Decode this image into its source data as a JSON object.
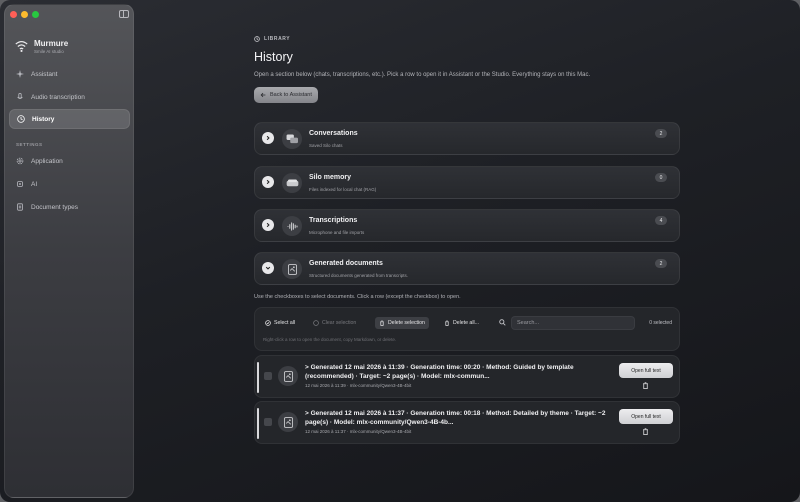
{
  "app": {
    "name": "Murmure",
    "subtitle": "Smile AI studio"
  },
  "sidebar": {
    "items": [
      {
        "label": "Assistant",
        "icon": "sparkle-icon"
      },
      {
        "label": "Audio transcription",
        "icon": "microphone-icon"
      },
      {
        "label": "History",
        "icon": "clock-icon",
        "active": true
      }
    ],
    "section_label": "SETTINGS",
    "settings_items": [
      {
        "label": "Application",
        "icon": "gear-icon"
      },
      {
        "label": "AI",
        "icon": "chip-icon"
      },
      {
        "label": "Document types",
        "icon": "document-icon"
      }
    ]
  },
  "header": {
    "breadcrumb": "LIBRARY",
    "title": "History",
    "description": "Open a section below (chats, transcriptions, etc.). Pick a row to open it in Assistant or the Studio. Everything stays on this Mac.",
    "back_label": "Back to Assistant"
  },
  "sections": [
    {
      "title": "Conversations",
      "subtitle": "Saved Silo chats",
      "count": "2",
      "icon": "chat-bubbles-icon",
      "expanded": false
    },
    {
      "title": "Silo memory",
      "subtitle": "Files indexed for local chat (RAG)",
      "count": "0",
      "icon": "drive-icon",
      "expanded": false
    },
    {
      "title": "Transcriptions",
      "subtitle": "Microphone and file imports",
      "count": "4",
      "icon": "waveform-icon",
      "expanded": false
    },
    {
      "title": "Generated documents",
      "subtitle": "Structured documents generated from transcripts.",
      "count": "2",
      "icon": "document-icon",
      "expanded": true
    }
  ],
  "documents_panel": {
    "hint": "Use the checkboxes to select documents. Click a row (except the checkbox) to open.",
    "select_all": "Select all",
    "clear_selection": "Clear selection",
    "delete_selection": "Delete selection",
    "delete_all": "Delete all...",
    "search_placeholder": "Search...",
    "selected_count": "0 selected",
    "toolbar_hint": "Right-click a row to open the document, copy Markdown, or delete.",
    "open_label": "Open full text"
  },
  "documents": [
    {
      "title": "> Generated 12 mai 2026 à 11:39 · Generation time: 00:20 · Method: Guided by template (recommended) · Target: ~2 page(s) · Model: mlx-commun...",
      "meta": "12 mai 2026 à 11:39 · mlx-community/Qwen3-4B-4bit"
    },
    {
      "title": "> Generated 12 mai 2026 à 11:37 · Generation time: 00:18 · Method: Detailed by theme · Target: ~2 page(s) · Model: mlx-community/Qwen3-4B-4b...",
      "meta": "12 mai 2026 à 11:37 · mlx-community/Qwen3-4B-4bit"
    }
  ],
  "colors": {
    "window_bg": "#1e2025",
    "sidebar_bg": "#3c3d42",
    "card_bg": "#2f3136",
    "accent_light": "#e8e8ea"
  }
}
